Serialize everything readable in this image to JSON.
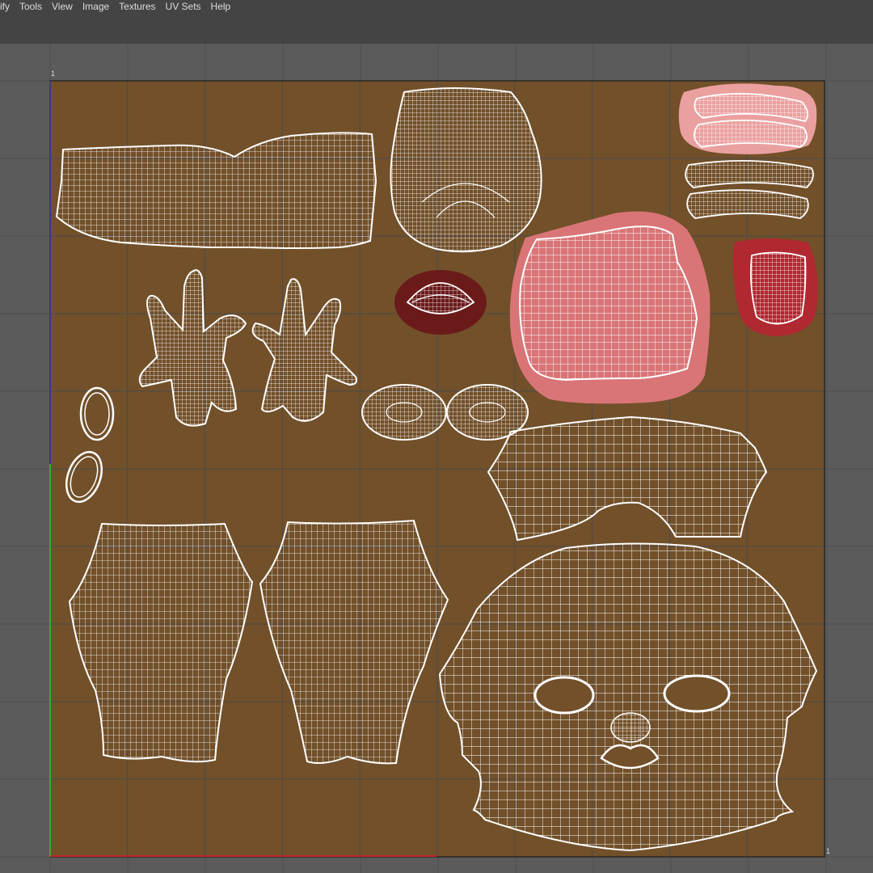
{
  "menubar": {
    "items": [
      {
        "label": "ify"
      },
      {
        "label": "Tools"
      },
      {
        "label": "View"
      },
      {
        "label": "Image"
      },
      {
        "label": "Textures"
      },
      {
        "label": "UV Sets"
      },
      {
        "label": "Help"
      }
    ]
  },
  "uv_editor": {
    "tile_color": "#72502a",
    "wire_color": "#ffffff",
    "grid_line_color": "#4a4a4a",
    "u_axis_color": "#c0272d",
    "v_axis_color": "#3aaa35",
    "axis_labels": {
      "top_left": "1",
      "bottom_right": "1"
    },
    "highlight_colors": {
      "light_pink": "#eba0a0",
      "salmon": "#d97577",
      "dark_red": "#6b1a1a",
      "red": "#b02830"
    },
    "shells": [
      {
        "name": "torso-band"
      },
      {
        "name": "head-back"
      },
      {
        "name": "teeth-upper"
      },
      {
        "name": "teeth-lower"
      },
      {
        "name": "hand-left"
      },
      {
        "name": "hand-right"
      },
      {
        "name": "mouth-interior"
      },
      {
        "name": "tongue"
      },
      {
        "name": "mouth-cavity"
      },
      {
        "name": "eye-left"
      },
      {
        "name": "eye-right"
      },
      {
        "name": "nail-ring-1"
      },
      {
        "name": "nail-ring-2"
      },
      {
        "name": "neck-band"
      },
      {
        "name": "leg-left"
      },
      {
        "name": "leg-right"
      },
      {
        "name": "face"
      }
    ]
  }
}
